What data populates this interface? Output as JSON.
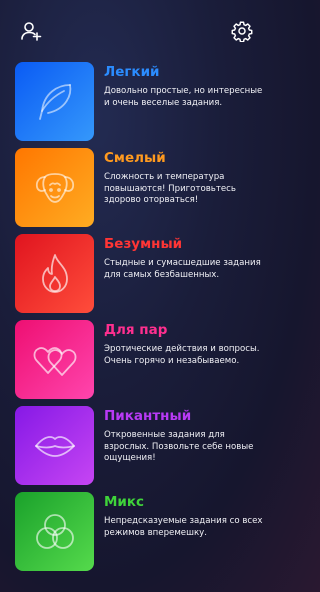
{
  "header": {
    "add_player_icon": "add-user-icon",
    "settings_icon": "gear-icon"
  },
  "modes": [
    {
      "title": "Легкий",
      "description": "Довольно простые, но интересные и очень веселые задания.",
      "title_color": "#2b8cff",
      "icon": "feather-icon",
      "gradient": [
        "#0a5bf4",
        "#2f95fb"
      ]
    },
    {
      "title": "Смелый",
      "description": "Сложность и температура повышаются! Приготовьтесь здорово оторваться!",
      "title_color": "#ff9a1f",
      "icon": "ram-icon",
      "gradient": [
        "#ff7700",
        "#ffaa1e"
      ]
    },
    {
      "title": "Безумный",
      "description": "Стыдные и сумасшедшие задания для самых безбашенных.",
      "title_color": "#ff3535",
      "icon": "flame-icon",
      "gradient": [
        "#e81a24",
        "#ff4b39"
      ]
    },
    {
      "title": "Для пар",
      "description": "Эротические действия и вопросы. Очень горячо и незабываемо.",
      "title_color": "#ff2f8f",
      "icon": "hearts-icon",
      "gradient": [
        "#f01277",
        "#ff3aa6"
      ]
    },
    {
      "title": "Пикантный",
      "description": "Откровенные задания для взрослых. Позвольте себе новые ощущения!",
      "title_color": "#b83af5",
      "icon": "lips-icon",
      "gradient": [
        "#8a1be6",
        "#c03ff2"
      ]
    },
    {
      "title": "Микс",
      "description": "Непредсказуемые задания со всех режимов вперемешку.",
      "title_color": "#3fd33a",
      "icon": "mix-circles-icon",
      "gradient": [
        "#1da52d",
        "#4fd749"
      ]
    }
  ]
}
